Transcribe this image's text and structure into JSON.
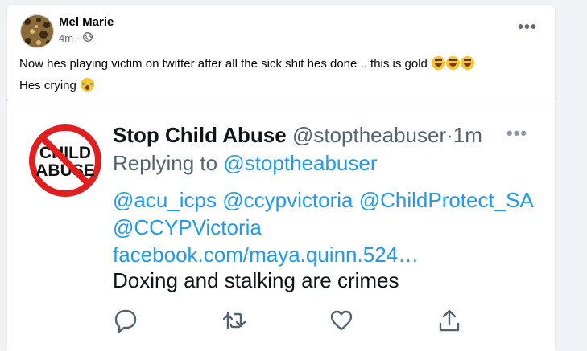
{
  "post": {
    "author": "Mel Marie",
    "time": "4m",
    "separator": "·",
    "privacy_icon": "globe-icon",
    "more_label": "•••",
    "line1": "Now hes playing victim on twitter after all the sick shit hes done .. this is gold",
    "line2": "Hes crying"
  },
  "tweet": {
    "avatar_text_top": "CHILD",
    "avatar_text_bottom": "ABUSE",
    "display_name": "Stop Child Abuse",
    "handle": "@stoptheabuser",
    "separator": "·",
    "time": "1m",
    "more_label": "•••",
    "replying_prefix": "Replying to",
    "replying_handle": "@stoptheabuser",
    "mention1": "@acu_icps",
    "mention2": "@ccypvictoria",
    "mention3": "@ChildProtect_SA",
    "mention4": "@CCYPVictoria",
    "link_url": "facebook.com/maya.quinn.524…",
    "text": "Doxing and stalking are crimes"
  },
  "colors": {
    "twitter_blue": "#1d9bf0",
    "badge_red": "#e02020",
    "fb_bg": "#f0f2f5"
  }
}
